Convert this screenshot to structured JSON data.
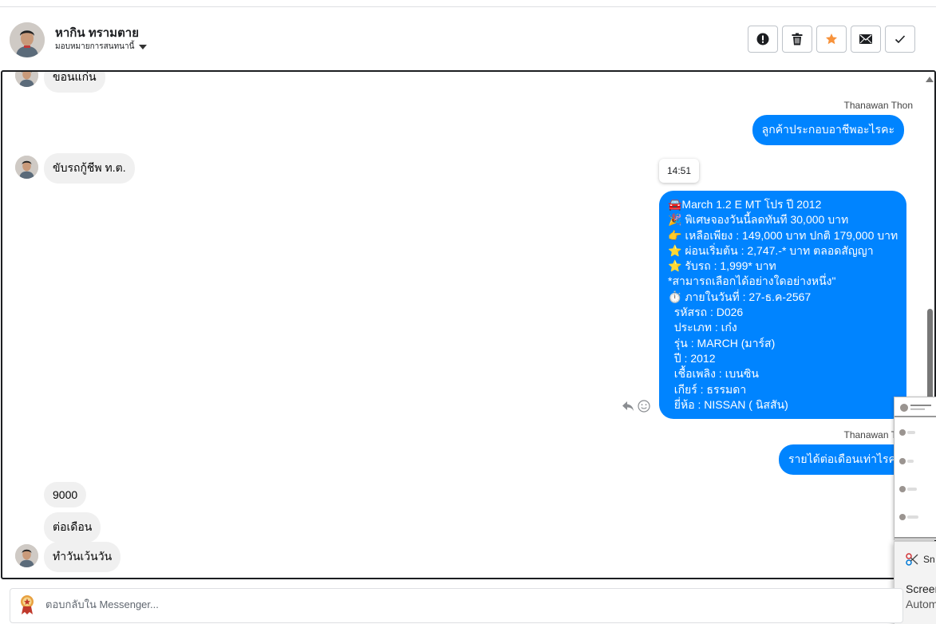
{
  "header": {
    "contact_name": "หากิน ทรามตาย",
    "assign_label": "มอบหมายการสนทนานี้",
    "actions": [
      {
        "name": "report",
        "icon": "exclamation-icon"
      },
      {
        "name": "delete",
        "icon": "trash-icon"
      },
      {
        "name": "star",
        "icon": "star-icon",
        "color": "#f7923b"
      },
      {
        "name": "mark-unread",
        "icon": "envelope-icon"
      },
      {
        "name": "mark-done",
        "icon": "checkmark-icon"
      }
    ]
  },
  "conversation": {
    "incoming_top": "ขอนแก่น",
    "sender_1": "Thanawan Thon",
    "out_1": "ลูกค้าประกอบอาชีพอะไรคะ",
    "in_1": "ขับรถกู้ชีพ ท.ต.",
    "timestamp": "14:51",
    "long_message": [
      "🚘March 1.2 E MT โปร ปี 2012",
      "🎉 พิเศษจองวันนี้ลดทันที 30,000 บาท",
      "👉 เหลือเพียง : 149,000 บาท ปกติ 179,000 บาท",
      "⭐ ผ่อนเริ่มต้น : 2,747.-* บาท ตลอดสัญญา",
      "⭐ รับรถ : 1,999* บาท",
      "*สามารถเลือกได้อย่างใดอย่างหนึ่ง\"",
      "⏱️ ภายในวันที่ : 27-ธ.ค-2567",
      "  รหัสรถ : D026",
      "  ประเภท : เก๋ง",
      "  รุ่น : MARCH (มาร์ส)",
      "  ปี : 2012",
      "  เชื้อเพลิง : เบนซิน",
      "  เกียร์ : ธรรมดา",
      "  ยี่ห้อ : NISSAN ( นิสสัน)"
    ],
    "sender_2": "Thanawan Thon",
    "out_2": "รายได้ต่อเดือนเท่าไรคะ",
    "in_2": "9000",
    "in_3": "ต่อเดือน",
    "in_4": "ทำวันเว้นวัน",
    "accent_color": "#0084ff"
  },
  "snip": {
    "app_label": "Sn",
    "title": "Screen",
    "subtitle": "Autom"
  },
  "composer": {
    "placeholder": "ตอบกลับใน Messenger..."
  }
}
